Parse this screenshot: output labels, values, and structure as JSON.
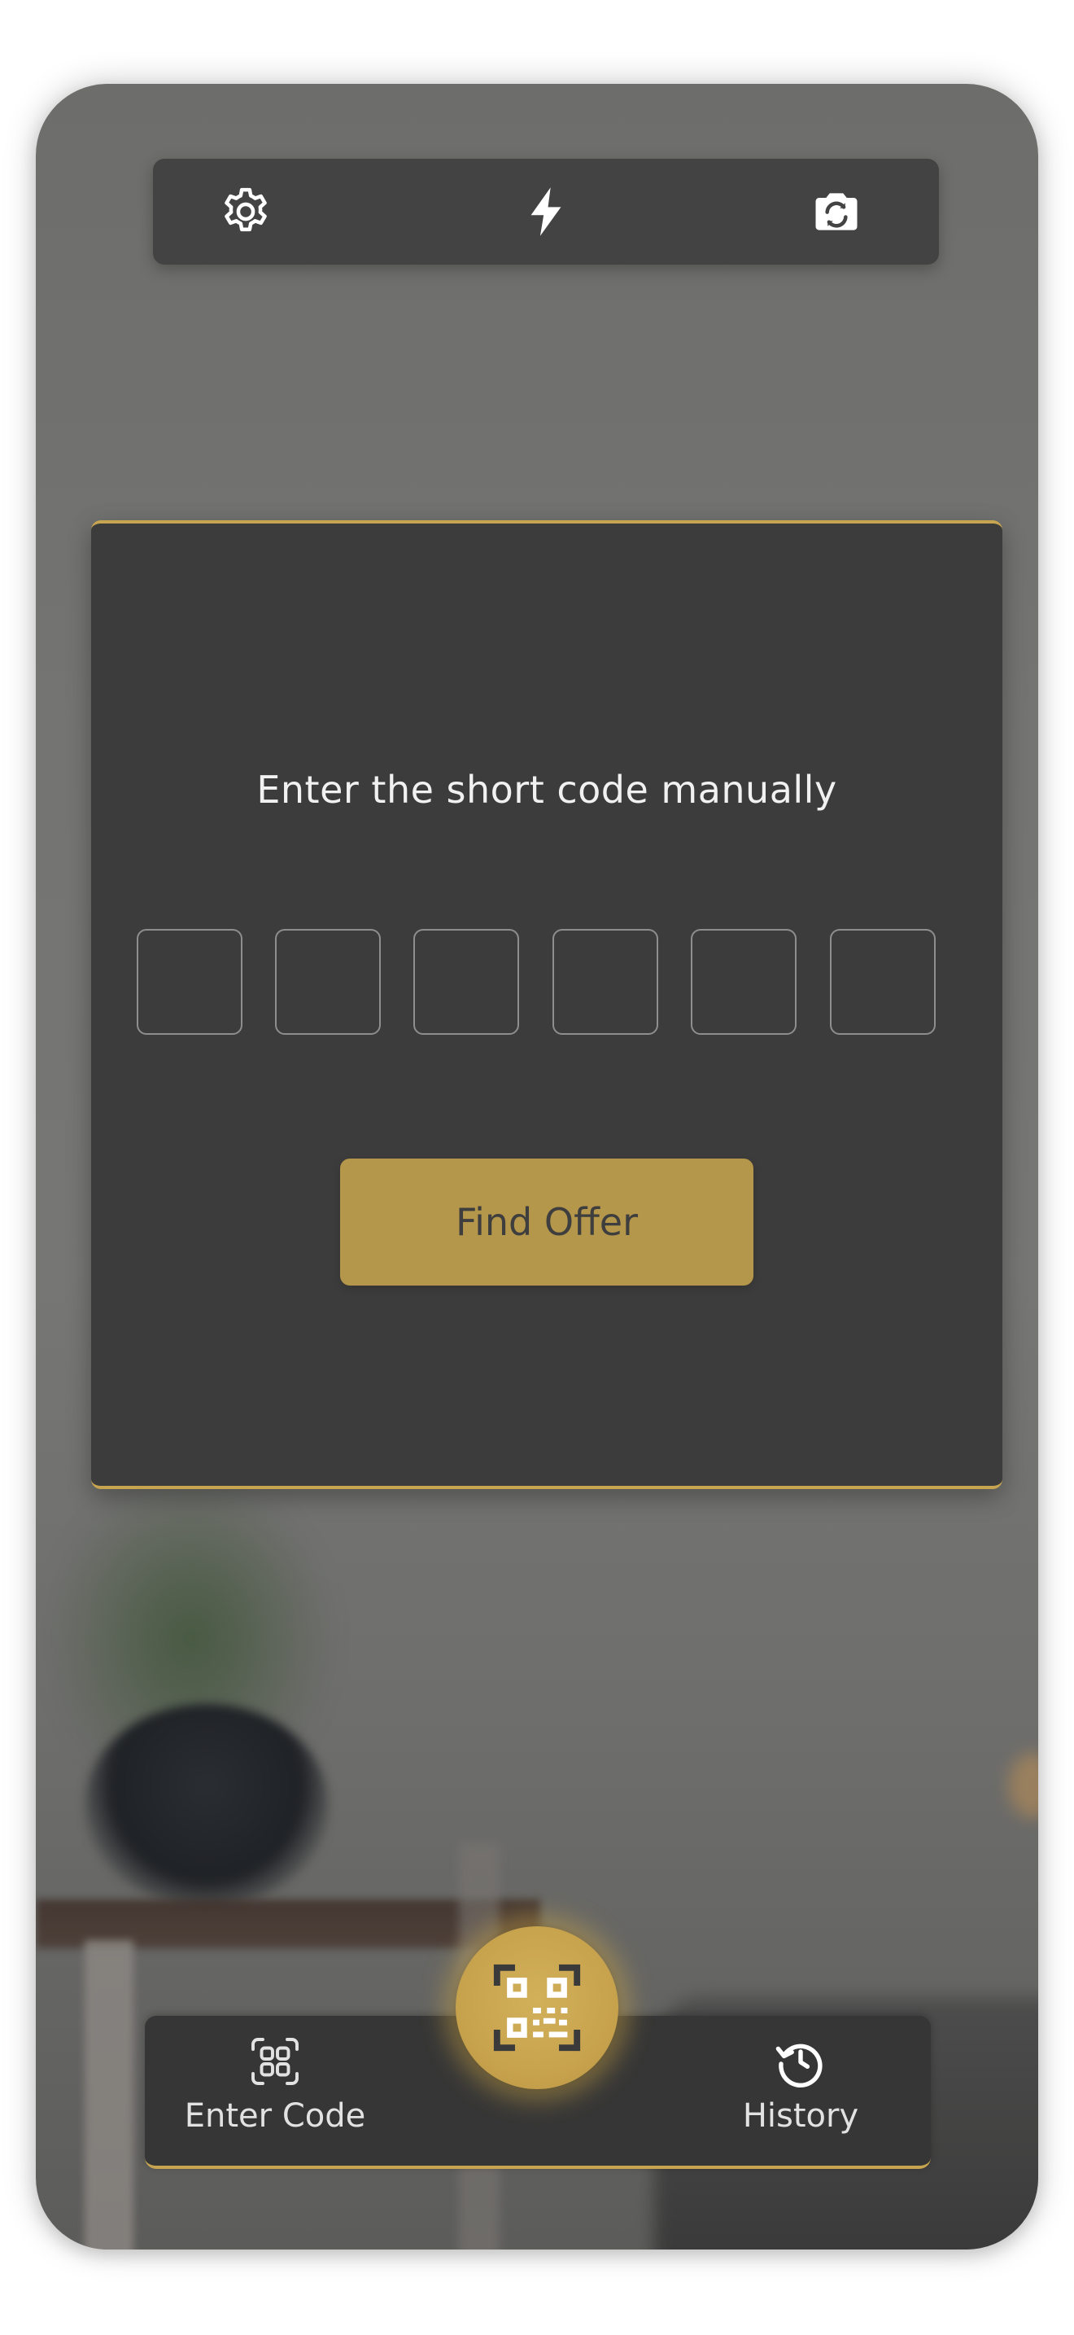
{
  "toolbar": {
    "icons": [
      "gear-icon",
      "flash-icon",
      "camera-switch-icon"
    ]
  },
  "manual_entry": {
    "prompt": "Enter the short code manually",
    "code_length": 6,
    "code_digits": [
      "",
      "",
      "",
      "",
      "",
      ""
    ],
    "find_button_label": "Find Offer"
  },
  "bottom_nav": {
    "enter_code_label": "Enter Code",
    "history_label": "History",
    "scan_icon": "qr-scan-icon"
  },
  "colors": {
    "accent_gold": "#c7a550",
    "button_gold": "#b5974b",
    "card_bg": "#3c3c3c",
    "toolbar_bg": "#434343",
    "nav_bg": "#363636"
  }
}
